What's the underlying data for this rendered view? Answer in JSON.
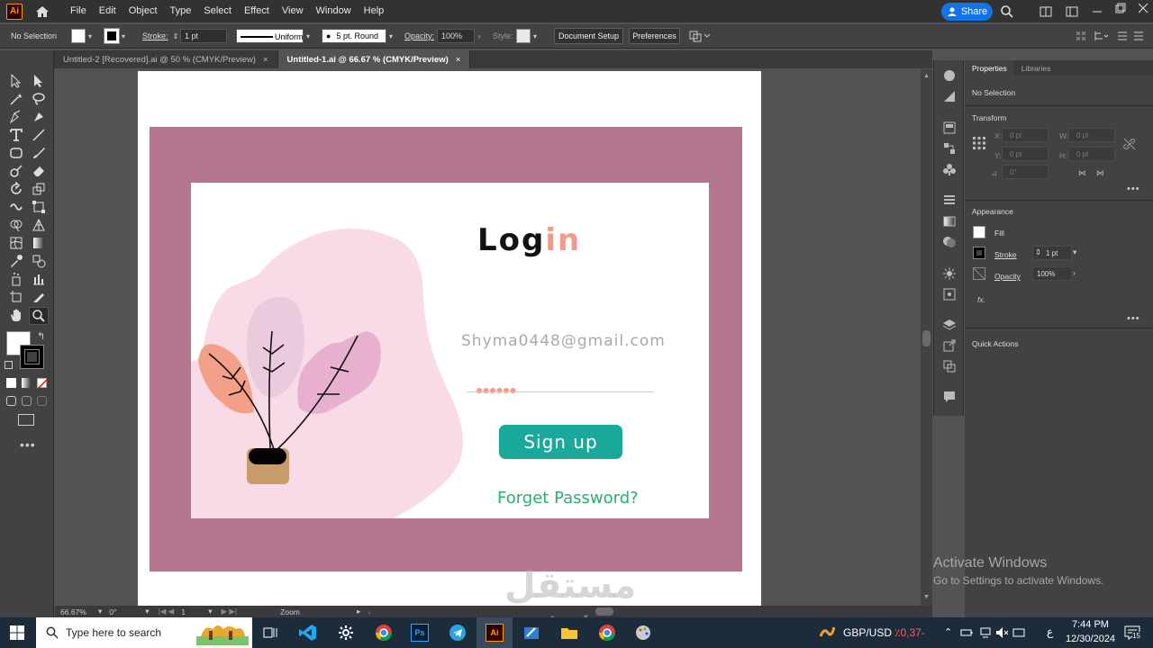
{
  "menu": {
    "items": [
      "File",
      "Edit",
      "Object",
      "Type",
      "Select",
      "Effect",
      "View",
      "Window",
      "Help"
    ],
    "app_logo": "Ai",
    "share_label": "Share"
  },
  "control": {
    "selection": "No Selection",
    "stroke_label": "Stroke:",
    "stroke_value": "1 pt",
    "profile": "Uniform",
    "brush": "5 pt. Round",
    "opacity_label": "Opacity:",
    "opacity_value": "100%",
    "style_label": "Style:",
    "doc_setup": "Document Setup",
    "preferences": "Preferences"
  },
  "tabs": [
    {
      "label": "Untitled-2 [Recovered].ai @ 50 % (CMYK/Preview)",
      "active": false
    },
    {
      "label": "Untitled-1.ai @ 66.67 % (CMYK/Preview)",
      "active": true
    }
  ],
  "artwork": {
    "login_main": "Log",
    "login_accent": "in",
    "email": "Shyma0448@gmail.com",
    "password_mask": "●●●●●●",
    "signup": "Sign up",
    "forget": "Forget Password?",
    "colors": {
      "frame": "#b5768f",
      "button": "#1aa89a",
      "accent": "#f1998a",
      "link": "#27b06f",
      "blob": "#f8dbe7"
    }
  },
  "status": {
    "zoom": "66.67%",
    "angle": "0°",
    "artboard": "1",
    "tool": "Zoom"
  },
  "panel": {
    "tab_properties": "Properties",
    "tab_libraries": "Libraries",
    "selection": "No Selection",
    "transform": "Transform",
    "x_label": "X:",
    "y_label": "Y:",
    "w_label": "W:",
    "h_label": "H:",
    "x_val": "0 pt",
    "y_val": "0 pt",
    "w_val": "0 pt",
    "h_val": "0 pt",
    "angle_val": "0°",
    "appearance": "Appearance",
    "fill": "Fill",
    "stroke": "Stroke",
    "stroke_val": "1 pt",
    "opacity": "Opacity",
    "opacity_val": "100%",
    "fx": "fx.",
    "quick_actions": "Quick Actions"
  },
  "windows": {
    "activate_title": "Activate Windows",
    "activate_sub": "Go to Settings to activate Windows."
  },
  "taskbar": {
    "search_placeholder": "Type here to search",
    "currency": "GBP/USD",
    "currency_change": "٪0,37-",
    "lang": "ع",
    "time": "7:44 PM",
    "date": "12/30/2024",
    "notifications": "15"
  },
  "watermark": {
    "arabic": "مستقل",
    "latin": "mostaql.com"
  }
}
